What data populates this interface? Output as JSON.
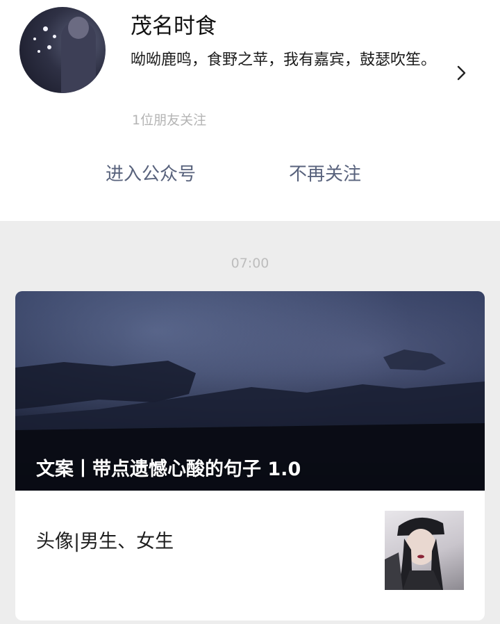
{
  "account": {
    "name": "茂名时食",
    "description": "呦呦鹿鸣，食野之苹，我有嘉宾，鼓瑟吹笙。",
    "follower_note": "1位朋友关注",
    "enter_label": "进入公众号",
    "unfollow_label": "不再关注"
  },
  "feed": {
    "timestamp": "07:00",
    "article": {
      "cover_title": "文案丨带点遗憾心酸的句子 1.0",
      "sub_title": "头像|男生、女生"
    }
  },
  "icons": {
    "chevron": "chevron-right-icon"
  },
  "colors": {
    "link": "#58627c",
    "muted": "#b4b4b4",
    "page_bg": "#ededed"
  }
}
